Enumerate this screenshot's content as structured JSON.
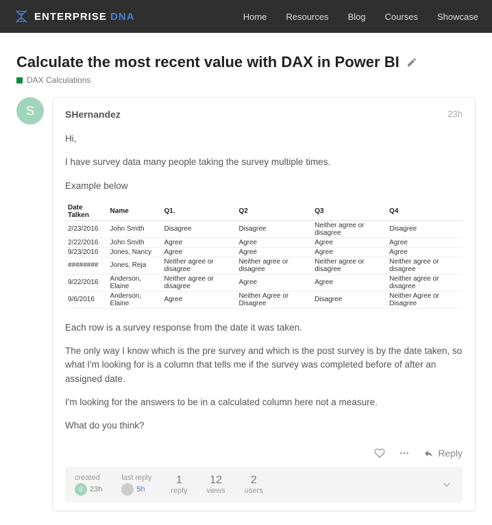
{
  "header": {
    "brand_prefix": "ENTERPRISE",
    "brand_suffix": "DNA",
    "nav": [
      "Home",
      "Resources",
      "Blog",
      "Courses",
      "Showcase"
    ]
  },
  "topic": {
    "title": "Calculate the most recent value with DAX in Power BI",
    "category": "DAX Calculations"
  },
  "post": {
    "avatar_letter": "S",
    "username": "SHernandez",
    "age": "23h",
    "paragraphs": {
      "p1": "Hi,",
      "p2": "I have survey data many people taking the survey multiple times.",
      "p3": "Example below",
      "p4": "Each row is a survey response from the date it was taken.",
      "p5": "The only way I know which is the pre survey and which is the post survey is by the date taken, so what I'm looking for is a column that tells me if the survey was completed before of after an assigned date.",
      "p6": "I'm looking for the answers to be in a calculated column here not a measure.",
      "p7": "What do you think?"
    },
    "table": {
      "headers": [
        "Date Talken",
        "Name",
        "Q1.",
        "Q2",
        "Q3",
        "Q4"
      ],
      "rows": [
        [
          "2/23/2016",
          "John Smith",
          "Disagree",
          "Disagree",
          "Neither agree or disagree",
          "Disagree"
        ],
        [
          "2/22/2016",
          "John Smith",
          "Agree",
          "Agree",
          "Agree",
          "Agree"
        ],
        [
          "9/23/2016",
          "Jones, Nancy",
          "Agree",
          "Agree",
          "Agree",
          "Agree"
        ],
        [
          "########",
          "Jones, Reja",
          "Neither agree or disagree",
          "Neither agree or disagree",
          "Neither agree or disagree",
          "Neither agree or disagree"
        ],
        [
          "9/22/2016",
          "Anderson, Elaine",
          "Neither agree or disagree",
          "Agree",
          "Agree",
          "Neither agree or disagree"
        ],
        [
          "9/6/2016",
          "Anderson, Elaine",
          "Agree",
          "Neither Agree or Disagree",
          "Disagree",
          "Neither Agree or Disagree"
        ]
      ]
    }
  },
  "actions": {
    "reply_label": "Reply"
  },
  "stats": {
    "created_label": "created",
    "created_val": "23h",
    "lastreply_label": "last reply",
    "lastreply_val": "5h",
    "reply_num": "1",
    "reply_lbl": "reply",
    "views_num": "12",
    "views_lbl": "views",
    "users_num": "2",
    "users_lbl": "users"
  }
}
